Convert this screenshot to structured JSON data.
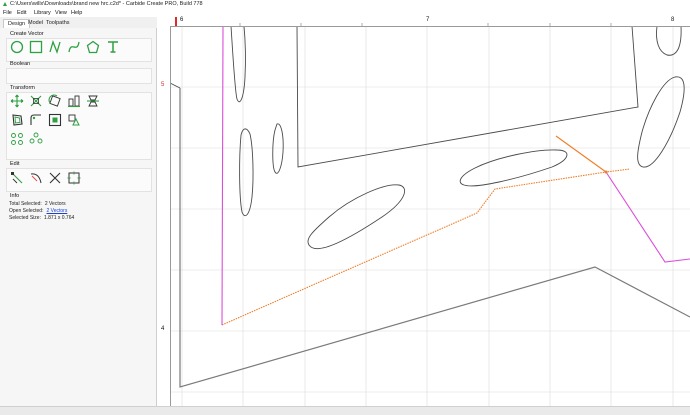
{
  "window": {
    "title": "C:\\Users\\willx\\Downloads\\brand new hrc.c2d* - Carbide Create PRO, Build 778"
  },
  "menu": [
    "File",
    "Edit",
    "Library",
    "View",
    "Help"
  ],
  "tabs": [
    "Design",
    "Model",
    "Toolpaths"
  ],
  "sections": {
    "create_vector": "Create Vector",
    "boolean": "Boolean",
    "transform": "Transform",
    "edit": "Edit",
    "info": "Info"
  },
  "info": {
    "total_selected_label": "Total Selected:",
    "total_selected_value": "2 Vectors",
    "open_selected_label": "Open Selected:",
    "open_selected_value": "2 Vectors",
    "selected_size_label": "Selected Size:",
    "selected_size_value": "1.871 x 0.764"
  },
  "ruler": {
    "top_labels": [
      "6",
      "7",
      "8"
    ],
    "left_labels": [
      "5",
      "4"
    ]
  },
  "colors": {
    "accent": "#2ea043",
    "selection_orange": "#f07d28",
    "selection_magenta": "#d94fd9",
    "vector_stroke": "#4a4a4a",
    "grid": "#dcdcdc"
  },
  "icons": {
    "create_vector": [
      "circle-icon",
      "rectangle-icon",
      "polyline-icon",
      "curve-icon",
      "polygon-icon",
      "text-icon"
    ],
    "transform": [
      "move-icon",
      "scale-icon",
      "rotate-icon",
      "align-icon",
      "mirror-icon",
      "offset-icon",
      "fillet-icon",
      "inset-icon",
      "trim-icon",
      "circle-array-icon",
      "grid-array-icon"
    ],
    "edit": [
      "node-edit-icon",
      "smooth-icon",
      "cut-icon",
      "rect-select-icon"
    ]
  }
}
